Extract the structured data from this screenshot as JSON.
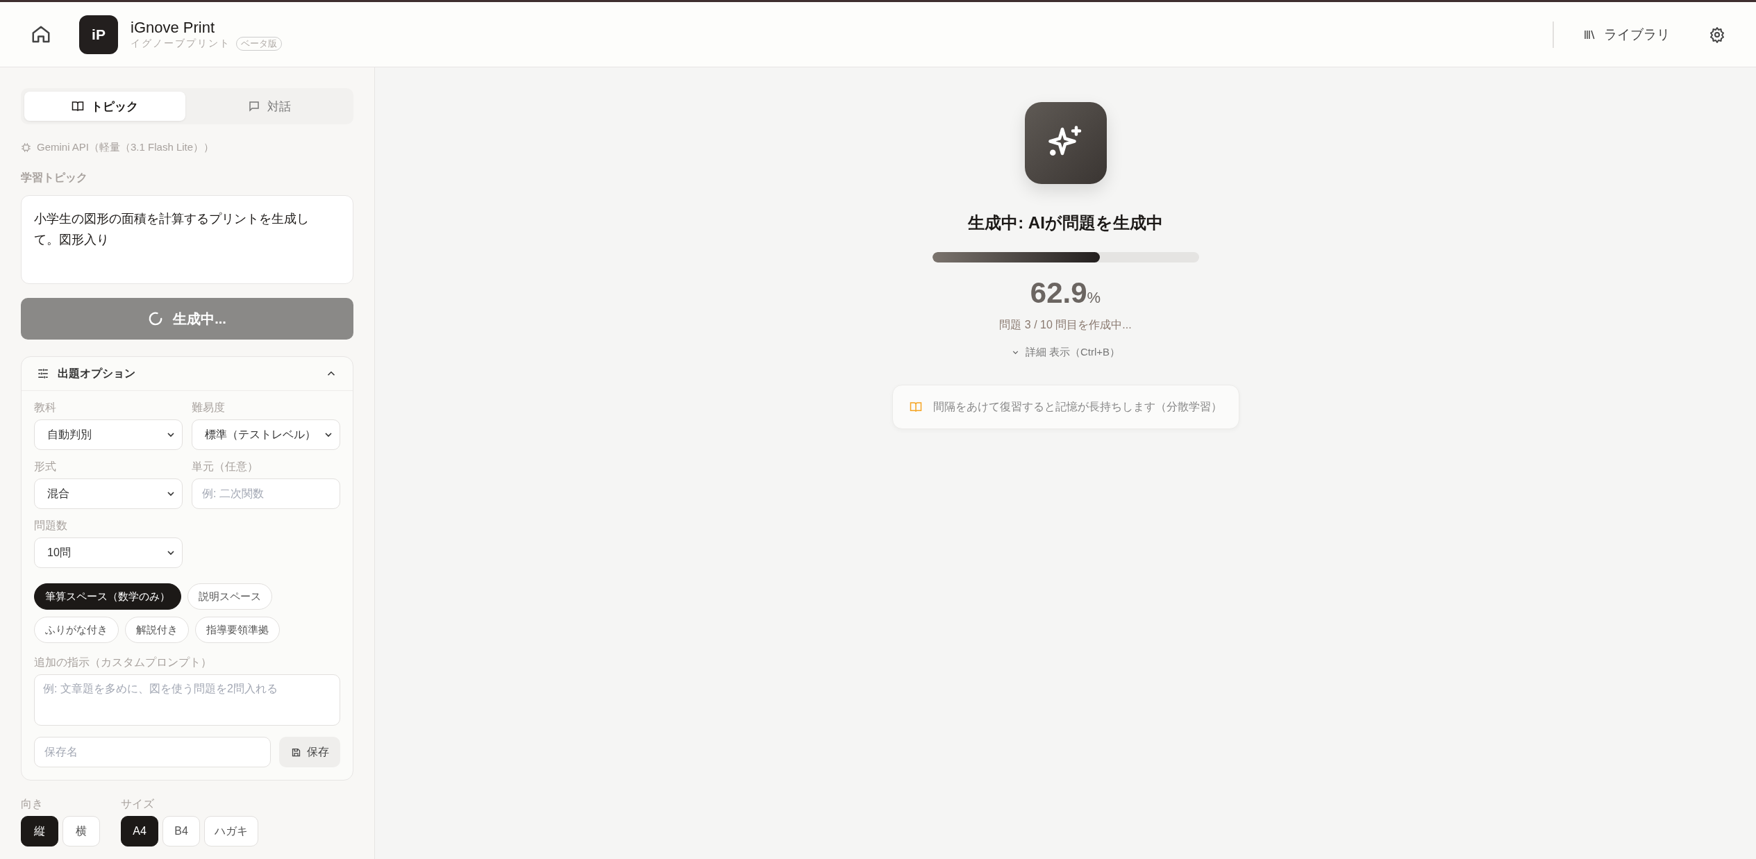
{
  "header": {
    "logo": "iP",
    "title": "iGnove Print",
    "subtitle": "イグノーブプリント",
    "badge": "ベータ版",
    "library": "ライブラリ"
  },
  "mode_tabs": [
    {
      "label": "トピック",
      "kind": "topic",
      "selected": true
    },
    {
      "label": "対話",
      "kind": "chat",
      "selected": false
    }
  ],
  "model": "Gemini API（軽量（3.1 Flash Lite））",
  "topic": {
    "label": "学習トピック",
    "value": "小学生の図形の面積を計算するプリントを生成して。図形入り"
  },
  "generate_button": {
    "label": "生成中...",
    "busy": true
  },
  "options": {
    "title": "出題オプション",
    "expanded": true,
    "fields": [
      {
        "kind": "select",
        "label": "教科",
        "value": "自動判別"
      },
      {
        "kind": "select",
        "label": "難易度",
        "value": "標準（テストレベル）"
      },
      {
        "kind": "select",
        "label": "形式",
        "value": "混合"
      },
      {
        "kind": "input",
        "label": "単元（任意）",
        "placeholder": "例: 二次関数"
      },
      {
        "kind": "select",
        "label": "問題数",
        "value": "10問"
      }
    ],
    "chips": [
      {
        "label": "筆算スペース（数学のみ）",
        "selected": true
      },
      {
        "label": "説明スペース",
        "selected": false
      },
      {
        "label": "ふりがな付き",
        "selected": false
      },
      {
        "label": "解説付き",
        "selected": false
      },
      {
        "label": "指導要領準拠",
        "selected": false
      }
    ],
    "custom_prompt": {
      "label": "追加の指示（カスタムプロンプト）",
      "placeholder": "例: 文章題を多めに、図を使う問題を2問入れる"
    },
    "save_name": {
      "placeholder": "保存名"
    },
    "save_button": "保存"
  },
  "orientation": {
    "label": "向き",
    "options": [
      {
        "label": "縦",
        "selected": true
      },
      {
        "label": "横",
        "selected": false
      }
    ]
  },
  "size": {
    "label": "サイズ",
    "options": [
      {
        "label": "A4",
        "selected": true
      },
      {
        "label": "B4",
        "selected": false
      },
      {
        "label": "ハガキ",
        "selected": false
      }
    ]
  },
  "progress": {
    "title": "生成中: AIが問題を生成中",
    "level": 0.629,
    "percent": "62.9",
    "unit": "%",
    "status": "問題 3 / 10 問目を作成中...",
    "details": "詳細 表示（Ctrl+B）"
  },
  "tip": "間隔をあけて復習すると記憶が長持ちします（分散学習）"
}
